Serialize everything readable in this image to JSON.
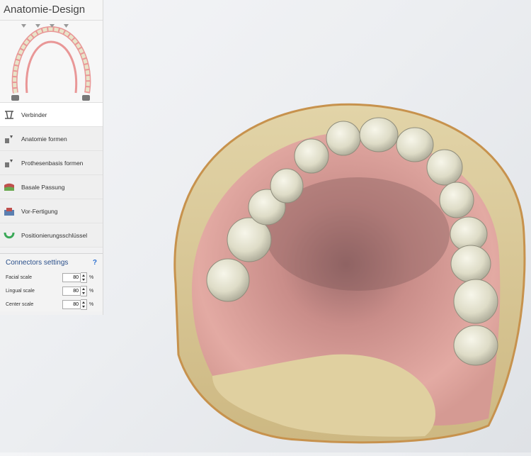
{
  "panel": {
    "title": "Anatomie-Design",
    "steps": [
      {
        "label": "Verbinder",
        "icon": "connector-icon"
      },
      {
        "label": "Anatomie formen",
        "icon": "anatomy-tool-icon"
      },
      {
        "label": "Prothesenbasis formen",
        "icon": "denture-base-tool-icon"
      },
      {
        "label": "Basale Passung",
        "icon": "basal-fit-icon"
      },
      {
        "label": "Vor-Fertigung",
        "icon": "pre-manufacturing-icon"
      },
      {
        "label": "Positionierungsschlüssel",
        "icon": "positioning-key-icon"
      }
    ],
    "active_step": "Verbinder"
  },
  "settings": {
    "title": "Connectors settings",
    "help": "?",
    "rows": [
      {
        "label": "Facial scale",
        "value": "80",
        "unit": "%"
      },
      {
        "label": "Lingual scale",
        "value": "80",
        "unit": "%"
      },
      {
        "label": "Center scale",
        "value": "80",
        "unit": "%"
      }
    ]
  },
  "colors": {
    "gum": "#d99c96",
    "base": "#d6c596",
    "teeth": "#e6e4d0",
    "accent": "#2a4f8a"
  }
}
